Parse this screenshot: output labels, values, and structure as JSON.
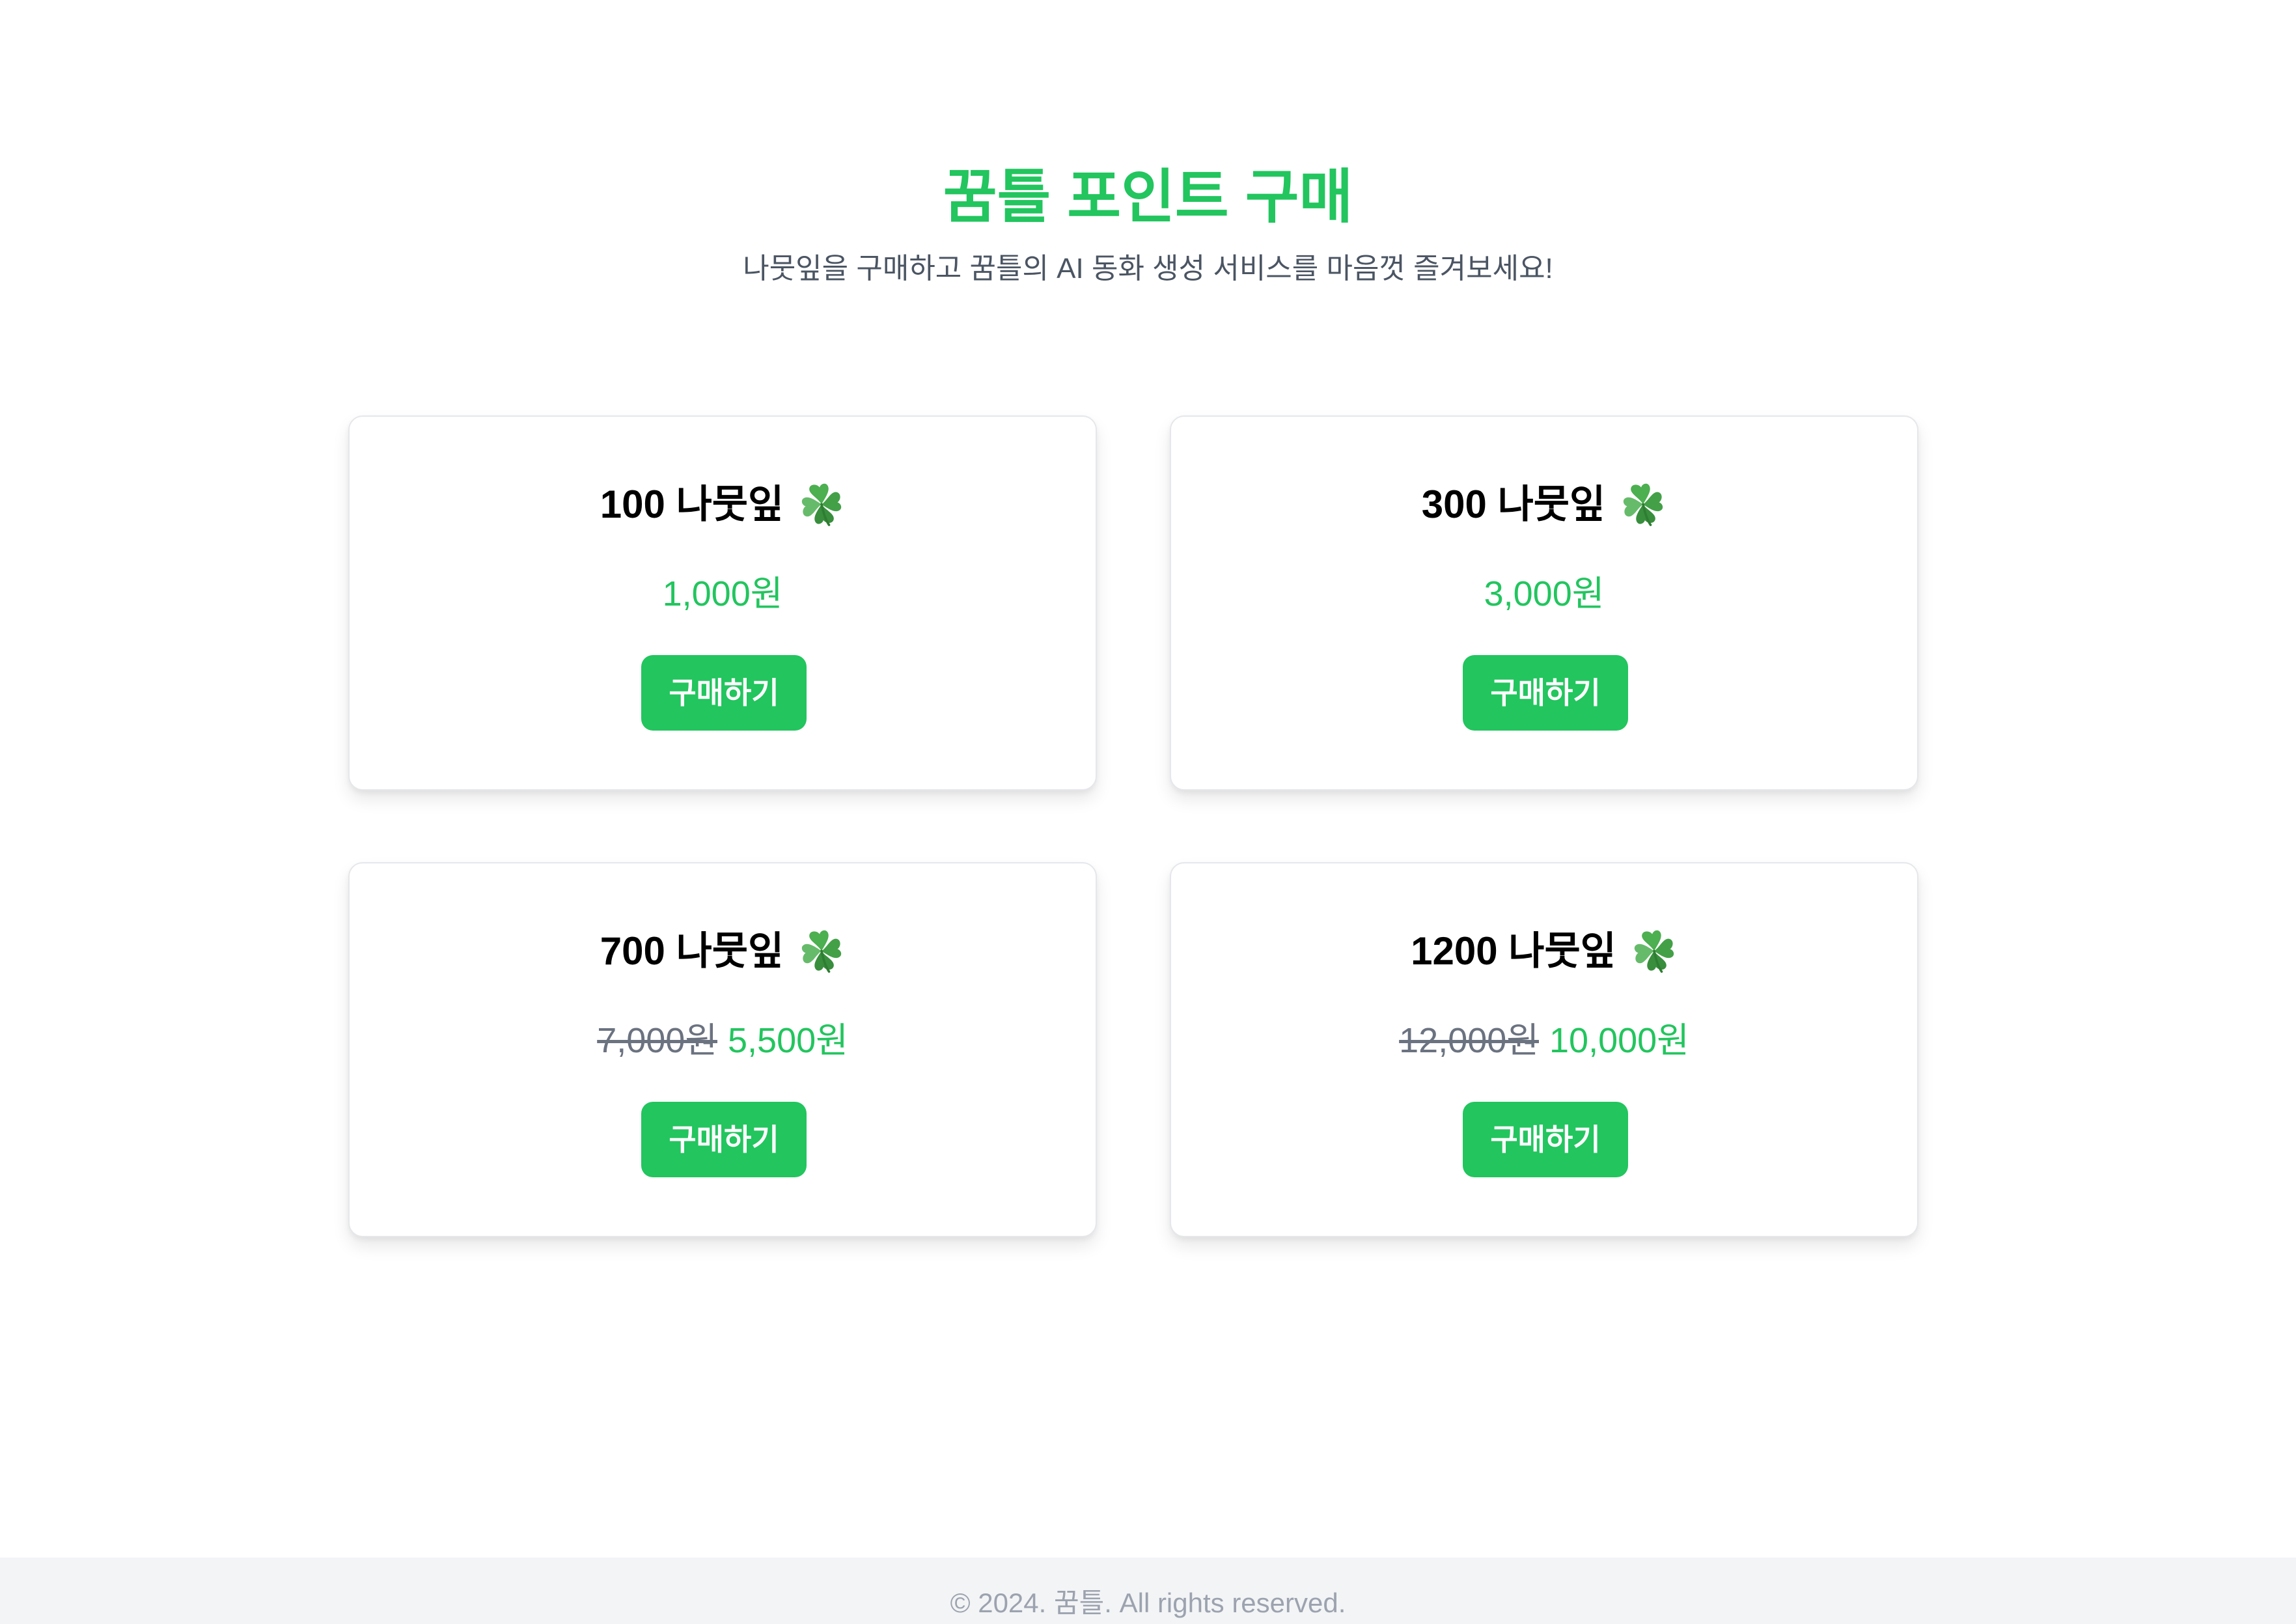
{
  "header": {
    "title": "꿈틀 포인트 구매",
    "subtitle": "나뭇잎을 구매하고 꿈틀의 AI 동화 생성 서비스를 마음껏 즐겨보세요!"
  },
  "packages": [
    {
      "title": "100 나뭇잎",
      "icon": "four-leaf-clover-icon",
      "original_price": "",
      "price": "1,000원",
      "button_label": "구매하기"
    },
    {
      "title": "300 나뭇잎",
      "icon": "four-leaf-clover-icon",
      "original_price": "",
      "price": "3,000원",
      "button_label": "구매하기"
    },
    {
      "title": "700 나뭇잎",
      "icon": "four-leaf-clover-icon",
      "original_price": "7,000원",
      "price": "5,500원",
      "button_label": "구매하기"
    },
    {
      "title": "1200 나뭇잎",
      "icon": "four-leaf-clover-icon",
      "original_price": "12,000원",
      "price": "10,000원",
      "button_label": "구매하기"
    }
  ],
  "footer": {
    "copyright": "© 2024. 꿈틀. All rights reserved."
  },
  "colors": {
    "accent": "#22c55e",
    "muted_text": "#6b7280",
    "footer_bg": "#f3f4f6"
  }
}
